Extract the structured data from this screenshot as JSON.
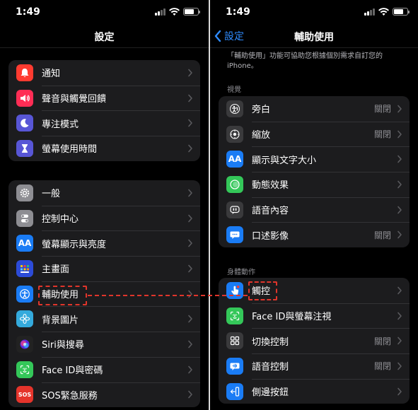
{
  "status": {
    "time": "1:49"
  },
  "left": {
    "title": "設定",
    "group1": [
      {
        "label": "通知",
        "icon": "bell-icon",
        "color": "#ff3b30"
      },
      {
        "label": "聲音與觸覺回饋",
        "icon": "speaker-icon",
        "color": "#ff2d55"
      },
      {
        "label": "專注模式",
        "icon": "moon-icon",
        "color": "#5856d6"
      },
      {
        "label": "螢幕使用時間",
        "icon": "hourglass-icon",
        "color": "#5856d6"
      }
    ],
    "group2": [
      {
        "label": "一般",
        "icon": "gear-icon",
        "color": "#8e8e93"
      },
      {
        "label": "控制中心",
        "icon": "switches-icon",
        "color": "#8e8e93"
      },
      {
        "label": "螢幕顯示與亮度",
        "icon": "text-size-icon",
        "color": "#1a7cf5",
        "glyph": "AA"
      },
      {
        "label": "主畫面",
        "icon": "home-screen-icon",
        "color": "#2c4bd8"
      },
      {
        "label": "輔助使用",
        "icon": "accessibility-icon",
        "color": "#1a7cf5"
      },
      {
        "label": "背景圖片",
        "icon": "flower-icon",
        "color": "#34aadc"
      },
      {
        "label": "Siri與搜尋",
        "icon": "siri-icon",
        "color": "#222222"
      },
      {
        "label": "Face ID與密碼",
        "icon": "face-id-icon",
        "color": "#34c759"
      },
      {
        "label": "SOS緊急服務",
        "icon": "sos-icon",
        "color": "#e5342b",
        "glyph": "SOS"
      }
    ]
  },
  "right": {
    "back_label": "設定",
    "title": "輔助使用",
    "description": "「輔助使用」功能可協助您根據個別需求自訂您的iPhone。",
    "vision_header": "視覺",
    "vision": [
      {
        "label": "旁白",
        "value": "關閉",
        "icon": "voiceover-icon",
        "color": "#3a3a3c"
      },
      {
        "label": "縮放",
        "value": "關閉",
        "icon": "zoom-icon",
        "color": "#3a3a3c"
      },
      {
        "label": "顯示與文字大小",
        "value": "",
        "icon": "text-size-icon",
        "color": "#1a7cf5",
        "glyph": "AA"
      },
      {
        "label": "動態效果",
        "value": "",
        "icon": "motion-icon",
        "color": "#34c759"
      },
      {
        "label": "語音內容",
        "value": "",
        "icon": "speech-bubble-icon",
        "color": "#3a3a3c"
      },
      {
        "label": "口述影像",
        "value": "關閉",
        "icon": "audio-description-icon",
        "color": "#1a7cf5"
      }
    ],
    "physical_header": "身體動作",
    "physical": [
      {
        "label": "觸控",
        "value": "",
        "icon": "touch-icon",
        "color": "#1a7cf5"
      },
      {
        "label": "Face ID與螢幕注視",
        "value": "",
        "icon": "face-id-icon",
        "color": "#34c759"
      },
      {
        "label": "切換控制",
        "value": "關閉",
        "icon": "switch-control-icon",
        "color": "#3a3a3c"
      },
      {
        "label": "語音控制",
        "value": "關閉",
        "icon": "voice-control-icon",
        "color": "#1a7cf5"
      },
      {
        "label": "側邊按鈕",
        "value": "",
        "icon": "side-button-icon",
        "color": "#1a7cf5"
      }
    ]
  }
}
